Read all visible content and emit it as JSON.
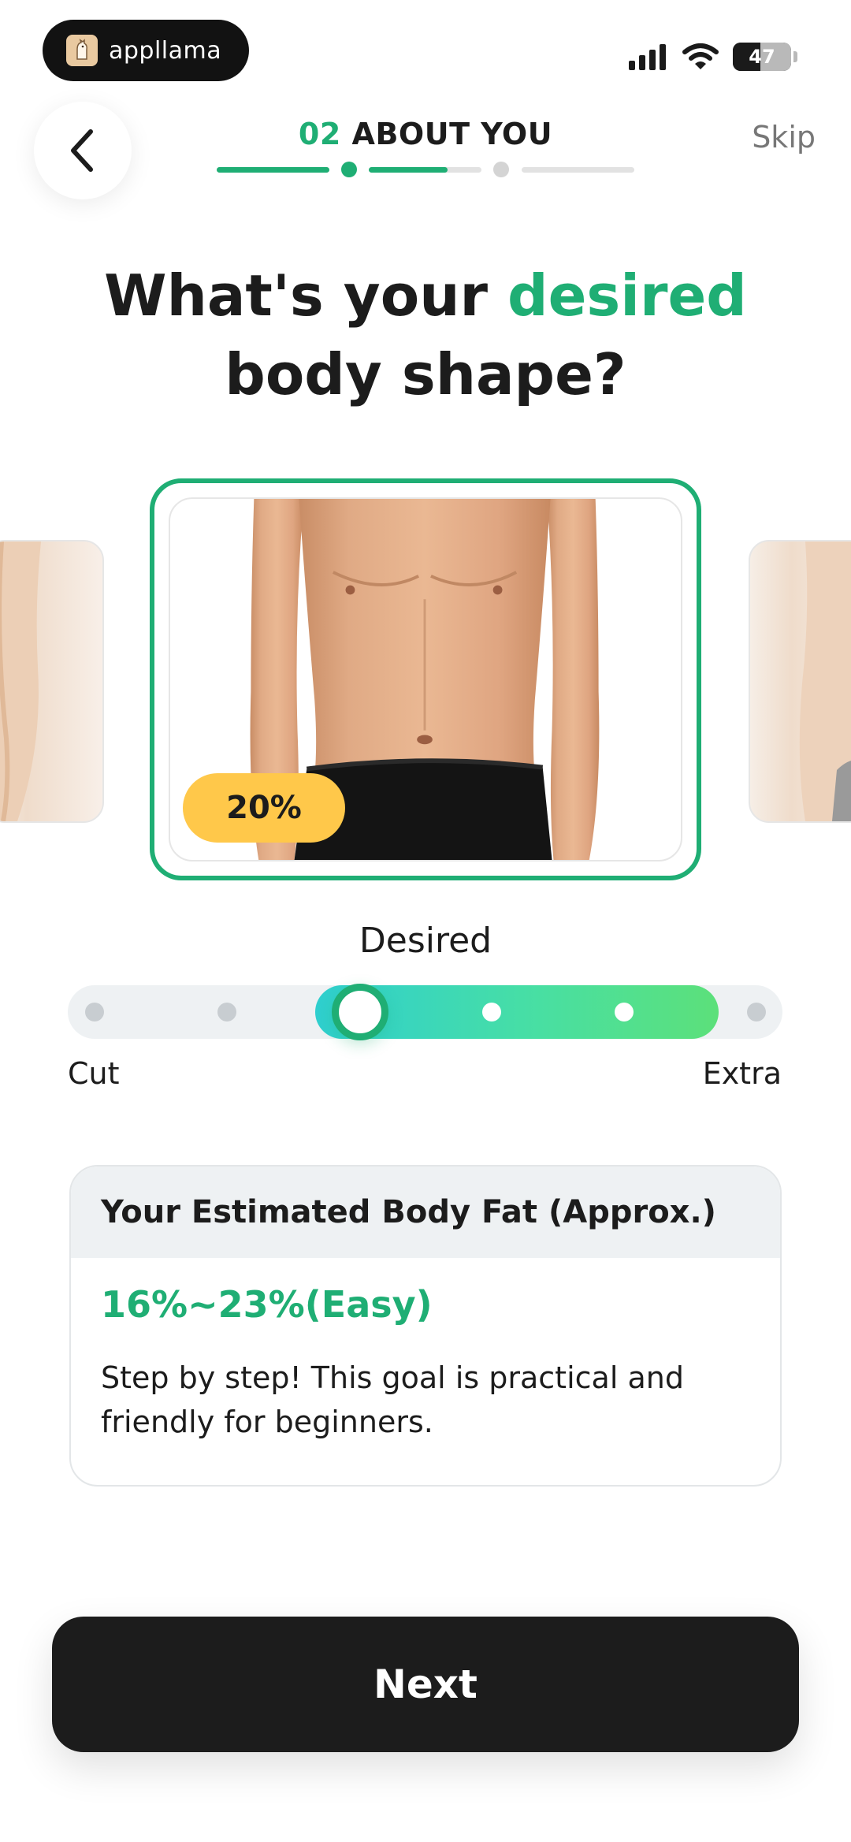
{
  "status_bar": {
    "app_pill_label": "appllama",
    "battery_level": "47"
  },
  "header": {
    "step_number": "02",
    "step_title": "ABOUT YOU",
    "skip_label": "Skip"
  },
  "question": {
    "prefix": "What's your ",
    "highlight": "desired",
    "suffix": "body shape?"
  },
  "carousel": {
    "selected_badge": "20%"
  },
  "slider": {
    "label": "Desired",
    "min_label": "Cut",
    "max_label": "Extra",
    "positions": 6,
    "current_index": 2,
    "range_end_index": 4
  },
  "info_card": {
    "title": "Your Estimated Body Fat (Approx.)",
    "range": "16%~23%(Easy)",
    "description": "Step by step! This goal is practical and friendly for beginners."
  },
  "footer": {
    "next_label": "Next"
  },
  "colors": {
    "accent": "#1fae74",
    "badge": "#ffc84a",
    "button": "#1c1c1c"
  }
}
